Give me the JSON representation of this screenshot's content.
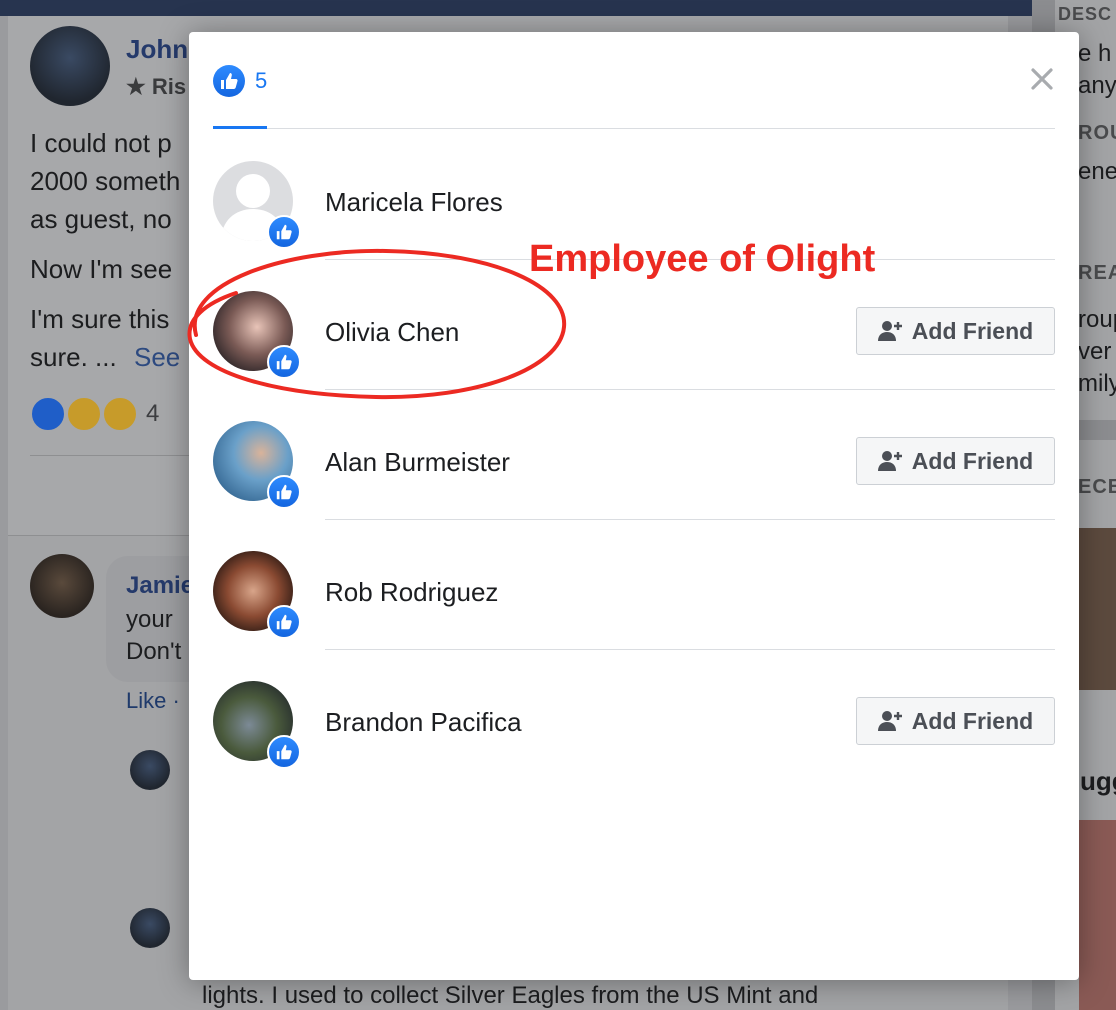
{
  "background": {
    "post_author": "John",
    "post_badge": "Ris",
    "post_lines": [
      "I could not p",
      "2000 someth",
      "as guest, no",
      "Now I'm see",
      "I'm sure this",
      "sure. ..."
    ],
    "see_more": "See",
    "reaction_count": "4",
    "comment_author": "Jamie",
    "comment_lines": [
      "your",
      "Don't"
    ],
    "comment_like": "Like ·",
    "bottom_text": "lights. I used to collect Silver Eagles from the US Mint and",
    "right_col_fragments": [
      "DESC",
      "e h",
      "any",
      "ROU",
      "ene",
      "REAT",
      "roup",
      "ver t",
      "mily",
      "ECE",
      "ugg"
    ]
  },
  "modal": {
    "tab": {
      "count": "5",
      "icon": "thumbs-up-icon"
    },
    "close_icon": "close-icon",
    "people": [
      {
        "name": "Maricela Flores",
        "show_add_friend": false
      },
      {
        "name": "Olivia Chen",
        "show_add_friend": true
      },
      {
        "name": "Alan Burmeister",
        "show_add_friend": true
      },
      {
        "name": "Rob Rodriguez",
        "show_add_friend": false
      },
      {
        "name": "Brandon Pacifica",
        "show_add_friend": true
      }
    ],
    "add_friend_label": "Add Friend"
  },
  "annotation": {
    "text": "Employee of Olight",
    "color": "#ec2a22"
  },
  "colors": {
    "facebook_blue": "#1877f2",
    "topbar": "#27344f"
  }
}
